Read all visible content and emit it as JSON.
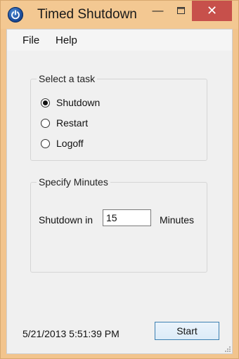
{
  "window": {
    "title": "Timed Shutdown",
    "icon": "power-icon",
    "controls": {
      "minimize": "minimize-icon",
      "maximize": "maximize-icon",
      "close": "close-icon"
    }
  },
  "menubar": {
    "items": [
      {
        "label": "File"
      },
      {
        "label": "Help"
      }
    ]
  },
  "task_group": {
    "title": "Select a task",
    "options": [
      {
        "label": "Shutdown",
        "checked": true
      },
      {
        "label": "Restart",
        "checked": false
      },
      {
        "label": "Logoff",
        "checked": false
      }
    ]
  },
  "minutes_group": {
    "title": "Specify Minutes",
    "prefix_label": "Shutdown in",
    "value": "15",
    "suffix_label": "Minutes"
  },
  "footer": {
    "datetime": "5/21/2013 5:51:39 PM",
    "start_label": "Start"
  },
  "colors": {
    "titlebar": "#f3c892",
    "close_button": "#c7504b",
    "client_background": "#f0f0f0",
    "start_border": "#3c7fb1"
  }
}
